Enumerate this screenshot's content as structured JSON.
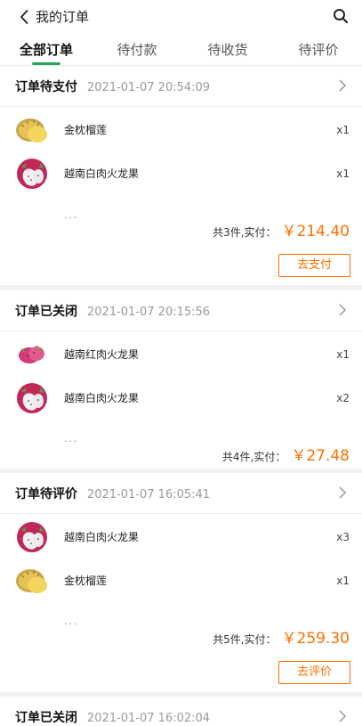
{
  "header": {
    "title": "我的订单",
    "back_icon": "back-arrow-icon",
    "search_icon": "search-icon"
  },
  "tabs": [
    {
      "label": "全部订单",
      "active": true
    },
    {
      "label": "待付款",
      "active": false
    },
    {
      "label": "待收货",
      "active": false
    },
    {
      "label": "待评价",
      "active": false
    }
  ],
  "colors": {
    "accent": "#22a655",
    "price": "#ff6f00"
  },
  "orders": [
    {
      "status": "订单待支付",
      "time": "2021-01-07 20:54:09",
      "items": [
        {
          "name": "金枕榴莲",
          "qty": "x1",
          "thumb": "durian"
        },
        {
          "name": "越南白肉火龙果",
          "qty": "x1",
          "thumb": "dragonfruit-white"
        }
      ],
      "more": "...",
      "total_label": "共3件,实付：",
      "total_price": "￥214.40",
      "action": "去支付"
    },
    {
      "status": "订单已关闭",
      "time": "2021-01-07 20:15:56",
      "items": [
        {
          "name": "越南红肉火龙果",
          "qty": "x1",
          "thumb": "dragonfruit-red"
        },
        {
          "name": "越南白肉火龙果",
          "qty": "x2",
          "thumb": "dragonfruit-white"
        }
      ],
      "more": "...",
      "total_label": "共4件,实付：",
      "total_price": "￥27.48"
    },
    {
      "status": "订单待评价",
      "time": "2021-01-07 16:05:41",
      "items": [
        {
          "name": "越南白肉火龙果",
          "qty": "x3",
          "thumb": "dragonfruit-white"
        },
        {
          "name": "金枕榴莲",
          "qty": "x1",
          "thumb": "durian"
        }
      ],
      "more": "...",
      "total_label": "共5件,实付：",
      "total_price": "￥259.30",
      "action": "去评价"
    },
    {
      "status": "订单已关闭",
      "time": "2021-01-07 16:02:04",
      "items": []
    }
  ]
}
